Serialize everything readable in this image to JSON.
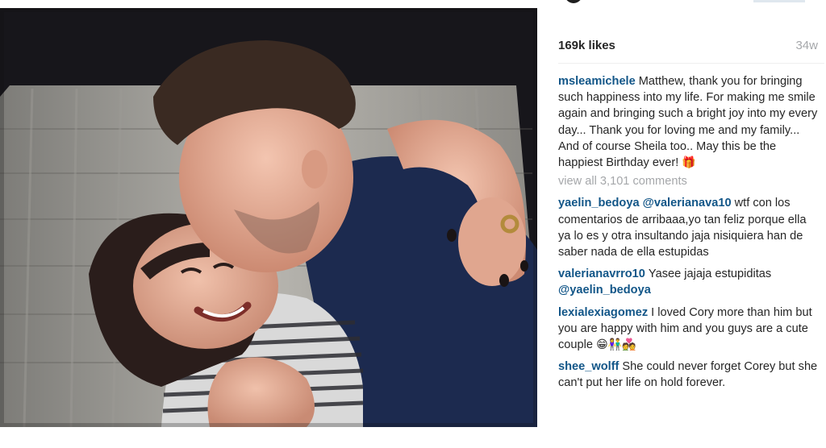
{
  "post": {
    "likes": "169k likes",
    "age": "34w",
    "caption": {
      "username": "msleamichele",
      "text": "Matthew, thank you for bringing such happiness into my life. For making me smile again and bringing such a bright joy into my every day... Thank you for loving me and my family... And of course Sheila too.. May this be the happiest Birthday ever!",
      "emoji": "🎁"
    },
    "view_all": "view all 3,101 comments",
    "comments": [
      {
        "username": "yaelin_bedoya",
        "mention": "@valerianava10",
        "text": "wtf con los comentarios de arribaaa,yo tan feliz porque ella ya lo es y otra insultando jaja nisiquiera han de saber nada de ella estupidas"
      },
      {
        "username": "valerianavrro10",
        "text": "Yasee jajaja estupiditas",
        "mention_after": "@yaelin_bedoya"
      },
      {
        "username": "lexialexiagomez",
        "text": "I loved Cory more than him but you are happy with him and you guys are a cute couple",
        "emoji": "😁👫💑"
      },
      {
        "username": "shee_wolff",
        "text": "She could never forget Corey but she can't put her life on hold forever."
      }
    ]
  },
  "colors": {
    "username": "#125688",
    "text": "#262626",
    "muted": "#a5a7aa"
  }
}
